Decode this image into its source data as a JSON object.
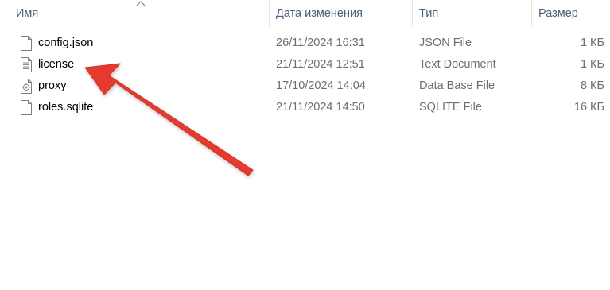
{
  "columns": {
    "name": "Имя",
    "date": "Дата изменения",
    "type": "Тип",
    "size": "Размер"
  },
  "sort": {
    "column": "name",
    "direction": "ascending",
    "icon": "sort-up-caret-icon"
  },
  "files": [
    {
      "name": "config.json",
      "date": "26/11/2024 16:31",
      "type": "JSON File",
      "size": "1 КБ",
      "icon": "blank-file-icon"
    },
    {
      "name": "license",
      "date": "21/11/2024 12:51",
      "type": "Text Document",
      "size": "1 КБ",
      "icon": "text-document-icon"
    },
    {
      "name": "proxy",
      "date": "17/10/2024 14:04",
      "type": "Data Base File",
      "size": "8 КБ",
      "icon": "database-file-icon"
    },
    {
      "name": "roles.sqlite",
      "date": "21/11/2024 14:50",
      "type": "SQLITE File",
      "size": "16 КБ",
      "icon": "blank-file-icon"
    }
  ],
  "annotation": {
    "icon": "red-pointer-arrow-icon",
    "target": "license",
    "color": "#e53b2f"
  },
  "colors": {
    "header_text": "#4c607a",
    "secondary_text": "#6d6d6d",
    "primary_text": "#000000",
    "arrow": "#e53b2f"
  }
}
